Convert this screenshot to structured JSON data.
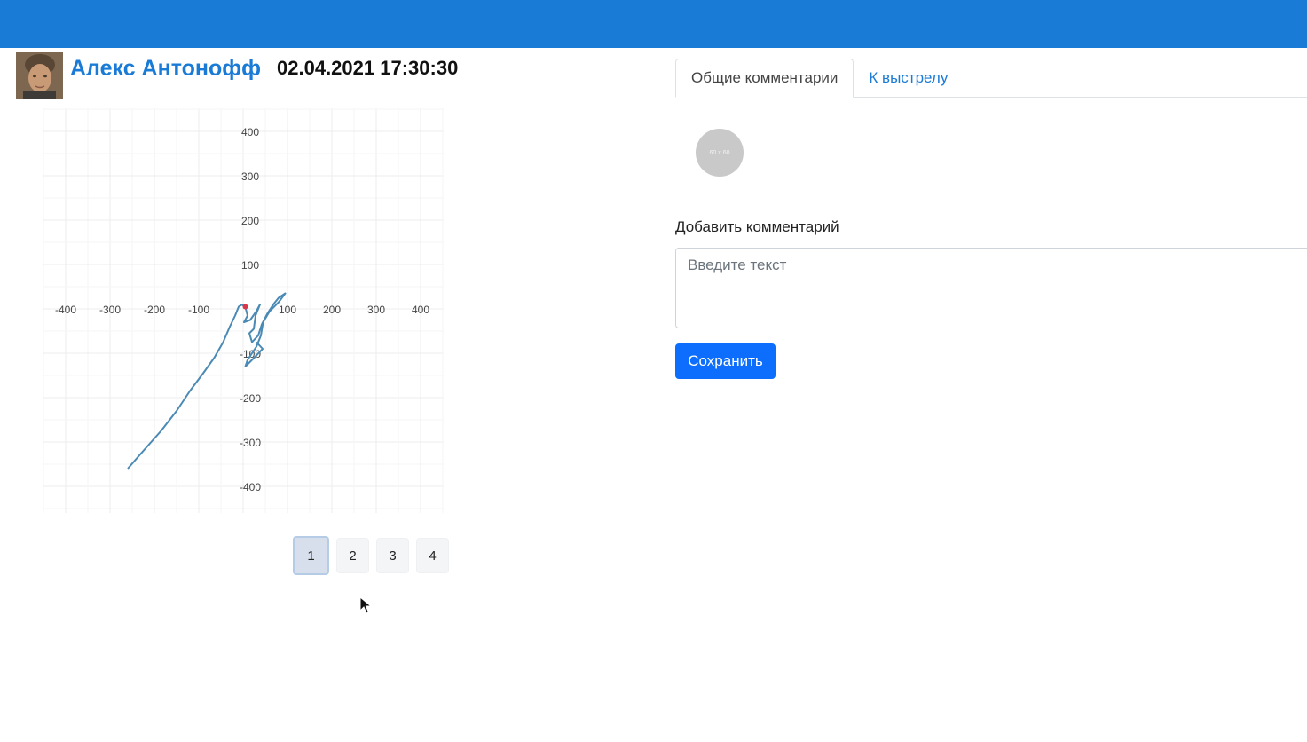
{
  "header": {
    "user_name": "Алекс Антонофф",
    "timestamp": "02.04.2021 17:30:30"
  },
  "colors": {
    "topbar": "#1a7bd6",
    "link": "#1a7bd6",
    "primary_button": "#0d6efd",
    "trace": "#4a8ab5",
    "hit_marker": "#d9364a"
  },
  "chart_data": {
    "type": "line",
    "xlim": [
      -450,
      450
    ],
    "ylim": [
      -450,
      450
    ],
    "grid": true,
    "x_ticks": [
      -400,
      -300,
      -200,
      -100,
      100,
      200,
      300,
      400
    ],
    "y_ticks": [
      400,
      300,
      200,
      100,
      -100,
      -200,
      -300,
      -400
    ],
    "series": [
      {
        "points": [
          [
            -260,
            -360
          ],
          [
            -225,
            -320
          ],
          [
            -185,
            -275
          ],
          [
            -150,
            -230
          ],
          [
            -120,
            -185
          ],
          [
            -90,
            -145
          ],
          [
            -65,
            -110
          ],
          [
            -45,
            -75
          ],
          [
            -30,
            -40
          ],
          [
            -18,
            -15
          ],
          [
            -10,
            5
          ],
          [
            -2,
            10
          ],
          [
            6,
            0
          ],
          [
            10,
            -15
          ],
          [
            2,
            -30
          ],
          [
            16,
            -25
          ],
          [
            30,
            -5
          ],
          [
            38,
            10
          ],
          [
            28,
            -15
          ],
          [
            24,
            -45
          ],
          [
            14,
            -55
          ],
          [
            20,
            -75
          ],
          [
            34,
            -60
          ],
          [
            42,
            -35
          ],
          [
            55,
            -10
          ],
          [
            68,
            10
          ],
          [
            80,
            25
          ],
          [
            95,
            35
          ],
          [
            80,
            15
          ],
          [
            60,
            -5
          ],
          [
            45,
            -30
          ],
          [
            40,
            -60
          ],
          [
            30,
            -85
          ],
          [
            20,
            -100
          ],
          [
            10,
            -115
          ],
          [
            5,
            -130
          ],
          [
            25,
            -110
          ],
          [
            44,
            -90
          ],
          [
            30,
            -75
          ]
        ]
      }
    ],
    "hit_point": [
      5,
      5
    ]
  },
  "pager": {
    "pages": [
      "1",
      "2",
      "3",
      "4"
    ],
    "active": 0
  },
  "tabs": [
    {
      "label": "Общие комментарии",
      "active": true
    },
    {
      "label": "К выстрелу",
      "active": false
    }
  ],
  "comments": {
    "avatar_placeholder": "60 x 60",
    "add_label": "Добавить комментарий",
    "input_placeholder": "Введите текст",
    "save_label": "Сохранить"
  },
  "icons": {
    "avatar": "user-photo-icon",
    "cursor": "mouse-pointer-icon"
  }
}
